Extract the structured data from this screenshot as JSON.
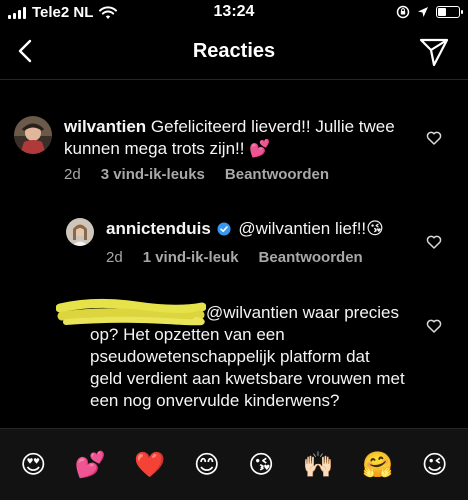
{
  "status_bar": {
    "carrier": "Tele2 NL",
    "time": "13:24"
  },
  "header": {
    "title": "Reacties",
    "back_icon": "chevron-left-icon",
    "send_icon": "paper-plane-icon"
  },
  "comments": [
    {
      "username": "wilvantien",
      "text": "Gefeliciteerd lieverd!! Jullie twee kunnen mega trots zijn!! 💕",
      "age": "2d",
      "likes": "3 vind-ik-leuks",
      "reply": "Beantwoorden"
    },
    {
      "username": "annictenduis",
      "verified": true,
      "text": "@wilvantien lief!!😘",
      "age": "2d",
      "likes": "1 vind-ik-leuk",
      "reply": "Beantwoorden"
    },
    {
      "username_redacted": true,
      "text": "@wilvantien waar precies op? Het opzetten van een pseudowetenschappelijk platform dat geld verdient aan kwetsbare vrouwen met een nog onvervulde kinderwens?"
    }
  ],
  "emoji_bar": [
    "😍",
    "💕",
    "❤️",
    "😊",
    "😘",
    "🙌🏻",
    "🤗",
    "😉"
  ],
  "colors": {
    "background": "#000000",
    "meta_text": "#a8a8a8",
    "verified_blue": "#3897f0",
    "scribble_yellow": "#e6e24a"
  }
}
